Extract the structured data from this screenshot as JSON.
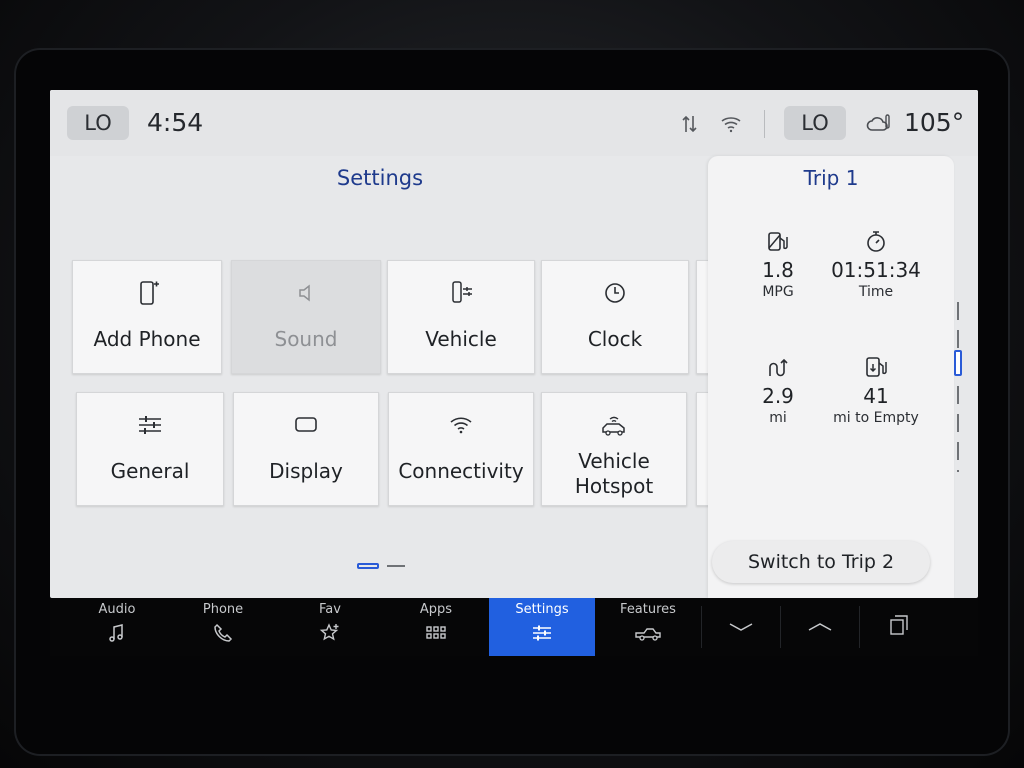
{
  "status_bar": {
    "left_climate": "LO",
    "time": "4:54",
    "right_climate": "LO",
    "outside_temp": "105°",
    "icons": [
      "data-arrows-icon",
      "wifi-info-icon",
      "cloud-thermometer-icon"
    ]
  },
  "settings": {
    "title": "Settings",
    "tiles": [
      {
        "label": "Add Phone",
        "icon": "add-phone-icon",
        "enabled": true
      },
      {
        "label": "Sound",
        "icon": "speaker-icon",
        "enabled": false
      },
      {
        "label": "Vehicle",
        "icon": "vehicle-settings-icon",
        "enabled": true
      },
      {
        "label": "Clock",
        "icon": "clock-icon",
        "enabled": true
      },
      {
        "label": "General",
        "icon": "sliders-icon",
        "enabled": true
      },
      {
        "label": "Display",
        "icon": "display-icon",
        "enabled": true
      },
      {
        "label": "Connectivity",
        "icon": "wifi-icon",
        "enabled": true
      },
      {
        "label": "Vehicle Hotspot",
        "line1": "Vehicle",
        "line2": "Hotspot",
        "icon": "vehicle-hotspot-icon",
        "enabled": true
      }
    ],
    "page_indicator": {
      "current": 1,
      "total": 2
    }
  },
  "trip": {
    "title": "Trip 1",
    "mpg": {
      "value": "1.8",
      "unit": "MPG"
    },
    "time": {
      "value": "01:51:34",
      "unit": "Time"
    },
    "distance": {
      "value": "2.9",
      "unit": "mi"
    },
    "range": {
      "value": "41",
      "unit": "mi to Empty"
    },
    "switch_label": "Switch to Trip 2"
  },
  "nav": {
    "items": [
      {
        "label": "Audio",
        "icon": "music-note-icon"
      },
      {
        "label": "Phone",
        "icon": "phone-icon"
      },
      {
        "label": "Fav",
        "icon": "star-plus-icon"
      },
      {
        "label": "Apps",
        "icon": "grid-icon"
      },
      {
        "label": "Settings",
        "icon": "sliders-icon",
        "active": true
      },
      {
        "label": "Features",
        "icon": "truck-icon"
      }
    ],
    "extra_icons": [
      "chevron-down-icon",
      "chevron-up-icon",
      "windows-stack-icon"
    ]
  },
  "colors": {
    "accent": "#2160e0",
    "title_blue": "#1e3a8c",
    "screen_bg": "#e7e8ea",
    "tile_bg": "#f6f6f7"
  }
}
